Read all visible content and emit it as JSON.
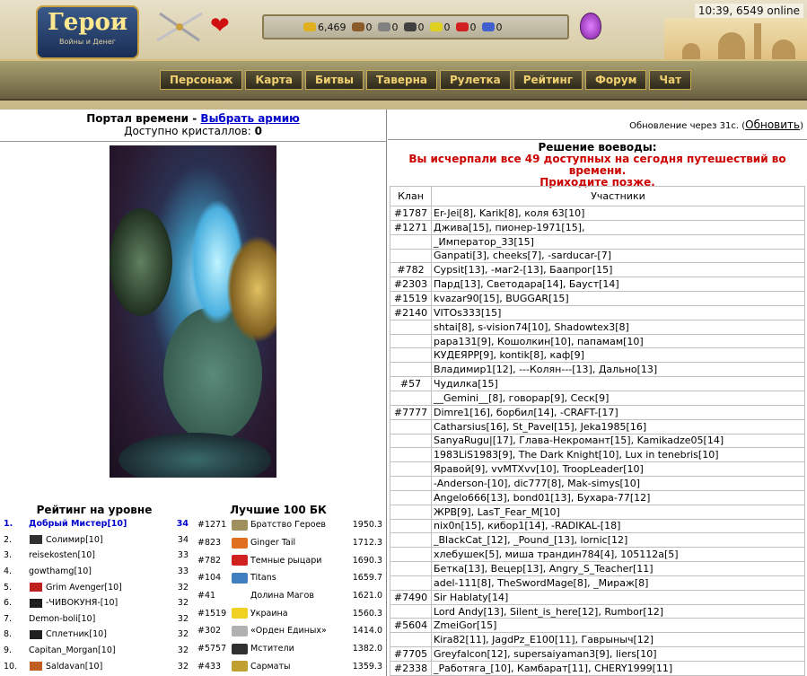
{
  "header": {
    "logo_title": "Герои",
    "logo_subtitle": "Войны и Денег",
    "time_online": "10:39, 6549 online",
    "resources": [
      {
        "name": "gold",
        "value": "6,469",
        "color": "#e0b020"
      },
      {
        "name": "wood",
        "value": "0",
        "color": "#8a5a2a"
      },
      {
        "name": "ore",
        "value": "0",
        "color": "#808080"
      },
      {
        "name": "mercury",
        "value": "0",
        "color": "#404040"
      },
      {
        "name": "sulfur",
        "value": "0",
        "color": "#e0d020"
      },
      {
        "name": "crystal",
        "value": "0",
        "color": "#d02020"
      },
      {
        "name": "gems",
        "value": "0",
        "color": "#4060d0"
      }
    ],
    "nav": [
      "Персонаж",
      "Карта",
      "Битвы",
      "Таверна",
      "Рулетка",
      "Рейтинг",
      "Форум",
      "Чат"
    ]
  },
  "portal": {
    "title": "Портал времени",
    "title_sep": " - ",
    "choose_army": "Выбрать армию",
    "crystals_label": "Доступно кристаллов: ",
    "crystals_value": "0"
  },
  "update": {
    "text": "Обновление через 31с. (",
    "link": "Обновить",
    "close": ")"
  },
  "decision": {
    "title": "Решение воеводы:",
    "line1": "Вы исчерпали все 49 доступных на сегодня путешествий во времени.",
    "line2": "Приходите позже."
  },
  "rating": {
    "title": "Рейтинг на уровне",
    "rows": [
      {
        "n": "1.",
        "name": "Добрый Мистер[10]",
        "value": "34"
      },
      {
        "n": "2.",
        "name": "Солимир[10]",
        "value": "34"
      },
      {
        "n": "3.",
        "name": "reisekosten[10]",
        "value": "33"
      },
      {
        "n": "4.",
        "name": "gowthamg[10]",
        "value": "33"
      },
      {
        "n": "5.",
        "name": "Grim Avenger[10]",
        "value": "32"
      },
      {
        "n": "6.",
        "name": "-ЧИВОКУНЯ-[10]",
        "value": "32"
      },
      {
        "n": "7.",
        "name": "Demon-boli[10]",
        "value": "32"
      },
      {
        "n": "8.",
        "name": "Сплетник[10]",
        "value": "32"
      },
      {
        "n": "9.",
        "name": "Capitan_Morgan[10]",
        "value": "32"
      },
      {
        "n": "10.",
        "name": "Saldavan[10]",
        "value": "32"
      }
    ]
  },
  "best": {
    "title": "Лучшие 100 БК",
    "rows": [
      {
        "id": "#1271",
        "name": "Братство Героев",
        "score": "1950.3",
        "color": "#a09060"
      },
      {
        "id": "#823",
        "name": "Ginger Tail",
        "score": "1712.3",
        "color": "#e07020"
      },
      {
        "id": "#782",
        "name": "Темные рыцари",
        "score": "1690.3",
        "color": "#d02020"
      },
      {
        "id": "#104",
        "name": "Titans",
        "score": "1659.7",
        "color": "#4080c0"
      },
      {
        "id": "#41",
        "name": "Долина Магов",
        "score": "1621.0",
        "color": "#ffffff"
      },
      {
        "id": "#1519",
        "name": "Украина",
        "score": "1560.3",
        "color": "#f0d020"
      },
      {
        "id": "#302",
        "name": "«Орден Единых»",
        "score": "1414.0",
        "color": "#b0b0b0"
      },
      {
        "id": "#5757",
        "name": "Мстители",
        "score": "1382.0",
        "color": "#303030"
      },
      {
        "id": "#433",
        "name": "Сарматы",
        "score": "1359.3",
        "color": "#c0a030"
      }
    ]
  },
  "table": {
    "col_clan": "Клан",
    "col_members": "Участники",
    "rows": [
      {
        "clan": "#1787",
        "members": "Er-Jei[8], Karik[8], коля 63[10]"
      },
      {
        "clan": "#1271",
        "members": "Джива[15], пионер-1971[15],"
      },
      {
        "clan": "",
        "members": "_Император_33[15]"
      },
      {
        "clan": "",
        "members": "Ganpati[3], cheeks[7], -sarducar-[7]"
      },
      {
        "clan": "#782",
        "members": "Cypsit[13], -маг2-[13], Баапрог[15]"
      },
      {
        "clan": "#2303",
        "members": "Пард[13], Светодара[14], Бауст[14]"
      },
      {
        "clan": "#1519",
        "members": "kvazar90[15], BUGGAR[15]"
      },
      {
        "clan": "#2140",
        "members": "VITOs333[15]"
      },
      {
        "clan": "",
        "members": "shtai[8], s-vision74[10], Shadowtex3[8]"
      },
      {
        "clan": "",
        "members": "papa131[9], Кошолкин[10], папамам[10]"
      },
      {
        "clan": "",
        "members": "КУДЕЯРР[9], kontik[8], каф[9]"
      },
      {
        "clan": "",
        "members": "Владимир1[12], ---Колян---[13], Дально[13]"
      },
      {
        "clan": "#57",
        "members": "Чудилка[15]"
      },
      {
        "clan": "",
        "members": "__Gemini__[8], говорар[9], Сеск[9]"
      },
      {
        "clan": "#7777",
        "members": "Dimre1[16], борбил[14], -CRAFT-[17]"
      },
      {
        "clan": "",
        "members": "Catharsius[16], St_Pavel[15], Jeka1985[16]"
      },
      {
        "clan": "",
        "members": "SanyaRugu|[17], Глава-Некромант[15], Kamikadze05[14]"
      },
      {
        "clan": "",
        "members": "1983LiS1983[9], The Dark Knight[10], Lux in tenebris[10]"
      },
      {
        "clan": "",
        "members": "Яравой[9], vvMTXvv[10], TroopLeader[10]"
      },
      {
        "clan": "",
        "members": "-Anderson-[10], dic777[8], Mak-simys[10]"
      },
      {
        "clan": "",
        "members": "Angelo666[13], bond01[13], Бухара-77[12]"
      },
      {
        "clan": "",
        "members": "ЖРВ[9], LasT_Fear_M[10]"
      },
      {
        "clan": "",
        "members": "nix0n[15], кибор1[14], -RADIKAL-[18]"
      },
      {
        "clan": "",
        "members": "_BlackCat_[12], _Pound_[13], lornic[12]"
      },
      {
        "clan": "",
        "members": "хлебушек[5], миша трандин784[4], 105112a[5]"
      },
      {
        "clan": "",
        "members": "Бетка[13], Вецер[13], Angry_S_Teacher[11]"
      },
      {
        "clan": "",
        "members": "adel-111[8], TheSwordMage[8], _Мираж[8]"
      },
      {
        "clan": "#7490",
        "members": "Sir Hablaty[14]"
      },
      {
        "clan": "",
        "members": "Lord Andy[13], Silent_is_here[12], Rumbor[12]"
      },
      {
        "clan": "#5604",
        "members": "ZmeiGor[15]"
      },
      {
        "clan": "",
        "members": "Kira82[11], JagdPz_E100[11], Гаврыныч[12]"
      },
      {
        "clan": "#7705",
        "members": "Greyfalcon[12], supersaiyaman3[9], liers[10]"
      },
      {
        "clan": "#2338",
        "members": "_Работяга_[10], Камбарат[11], CHERY1999[11]"
      }
    ]
  }
}
